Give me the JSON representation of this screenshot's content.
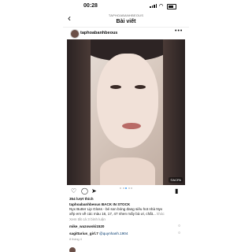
{
  "status_bar": {
    "time": "00:28"
  },
  "nav": {
    "back": "‹",
    "subtitle": "TAPHOABANHBEOUS",
    "title": "Bài viết"
  },
  "post": {
    "username": "taphoabanhbeous",
    "more": "•••",
    "watermark": "©ACPA",
    "actions": {
      "like_icon": "heart-icon",
      "comment_icon": "comment-icon",
      "share_icon": "send-icon",
      "save_icon": "bookmark-icon"
    },
    "likes": "354 lượt thích",
    "caption_line1": "taphoabanhbeous BACK IN STOCK",
    "caption_line2": "Nyx Butter Lip Gloss - bé son bóng đang siêu hot nhà Nyx",
    "caption_line3": "xếp em về các màu 16, 17, 47 nhen mấy bà ưi, chất... ",
    "caption_more": "khác",
    "view_all_comments": "Xem tất cả 3 bình luận",
    "comments": [
      {
        "user": "mike_wazowski1520",
        "text": ""
      },
      {
        "user": "sagittarius_girl.7",
        "text": "@quynhanh.1904"
      }
    ],
    "date": "8 tháng 4"
  },
  "colors": {
    "accent": "#3897f0",
    "muted": "#8e8e8e"
  }
}
